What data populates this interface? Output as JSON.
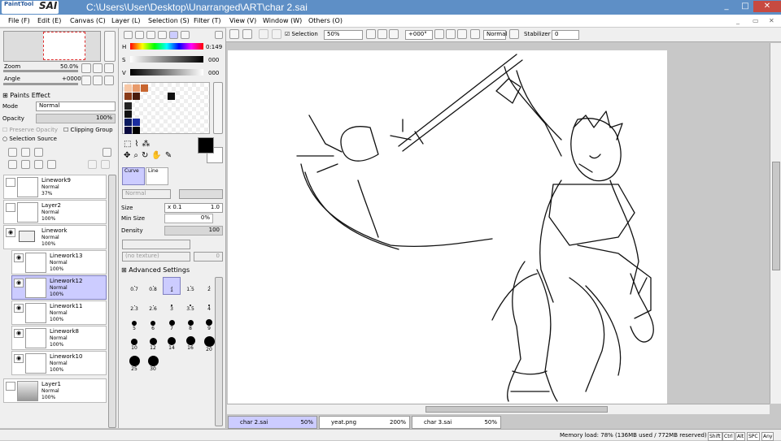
{
  "window": {
    "title": "C:\\Users\\User\\Desktop\\Unarranged\\ART\\char 2.sai",
    "logo_top": "PaintTool",
    "logo_main": "SAI",
    "minimize": "_",
    "maximize": "□",
    "close": "✕"
  },
  "menu": [
    "File (F)",
    "Edit (E)",
    "Canvas (C)",
    "Layer (L)",
    "Selection (S)",
    "Filter (T)",
    "View (V)",
    "Window (W)",
    "Others (O)"
  ],
  "navigator": {
    "zoom_label": "Zoom",
    "zoom_value": "50.0%",
    "angle_label": "Angle",
    "angle_value": "+0000"
  },
  "layer_panel": {
    "paints_effect": "Paints Effect",
    "mode_label": "Mode",
    "mode_value": "Normal",
    "opacity_label": "Opacity",
    "opacity_value": "100%",
    "opacity_fraction": 1.0,
    "preserve_opacity": "Preserve Opacity",
    "clipping_group": "Clipping Group",
    "selection_source": "Selection Source",
    "layers": [
      {
        "name": "Linework9",
        "mode": "Normal",
        "opacity": "37%",
        "selected": false,
        "indent": false
      },
      {
        "name": "Layer2",
        "mode": "Normal",
        "opacity": "100%",
        "selected": false,
        "indent": false
      },
      {
        "name": "Linework",
        "mode": "Normal",
        "opacity": "100%",
        "selected": false,
        "indent": false,
        "folder": true
      },
      {
        "name": "Linework13",
        "mode": "Normal",
        "opacity": "100%",
        "selected": false,
        "indent": true
      },
      {
        "name": "Linework12",
        "mode": "Normal",
        "opacity": "100%",
        "selected": true,
        "indent": true
      },
      {
        "name": "Linework11",
        "mode": "Normal",
        "opacity": "100%",
        "selected": false,
        "indent": true
      },
      {
        "name": "Linework8",
        "mode": "Normal",
        "opacity": "100%",
        "selected": false,
        "indent": true
      },
      {
        "name": "Linework10",
        "mode": "Normal",
        "opacity": "100%",
        "selected": false,
        "indent": true
      },
      {
        "name": "Layer1",
        "mode": "Normal",
        "opacity": "100%",
        "selected": false,
        "indent": false
      }
    ]
  },
  "color_panel": {
    "h_label": "H",
    "h_value": "0:149",
    "s_label": "S",
    "s_value": "000",
    "v_label": "V",
    "v_value": "000",
    "swatches": [
      "#f7c7a5",
      "#e89a6a",
      "#c8652f",
      "#8a3b18",
      "#4a1d0d",
      "#111111",
      "#222222",
      "#111111",
      "#0a1a60",
      "#1b2da0",
      "#0a0a40",
      "#000000"
    ],
    "primary": "#000000",
    "secondary": "#ffffff"
  },
  "tool_panel": {
    "tool_curve": "Curve",
    "tool_line": "Line",
    "mode_value": "Normal",
    "size_label": "Size",
    "size_mult": "x 0.1",
    "size_value": "1.0",
    "min_size_label": "Min Size",
    "min_size_value": "0%",
    "density_label": "Density",
    "density_value": "100",
    "texture_value": "(no texture)",
    "texture_value2": "0",
    "advanced": "Advanced Settings",
    "brush_sizes": [
      "0.7",
      "0.8",
      "1",
      "1.5",
      "2",
      "2.3",
      "2.6",
      "3",
      "3.5",
      "4",
      "5",
      "6",
      "7",
      "8",
      "9",
      "10",
      "12",
      "14",
      "16",
      "20",
      "25",
      "30"
    ]
  },
  "toolbar": {
    "selection_label": "Selection",
    "zoom_value": "50%",
    "angle_value": "+000°",
    "blend_value": "Normal",
    "stabilizer_label": "Stabilizer",
    "stabilizer_value": "0"
  },
  "tabs": [
    {
      "name": "char 2.sai",
      "zoom": "50%",
      "selected": true
    },
    {
      "name": "yeat.png",
      "zoom": "200%",
      "selected": false
    },
    {
      "name": "char 3.sai",
      "zoom": "50%",
      "selected": false
    }
  ],
  "status": {
    "memory": "Memory load: 78% (136MB used / 772MB reserved)",
    "keys": [
      "Shift",
      "Ctrl",
      "Alt",
      "SPC",
      "Any"
    ]
  }
}
